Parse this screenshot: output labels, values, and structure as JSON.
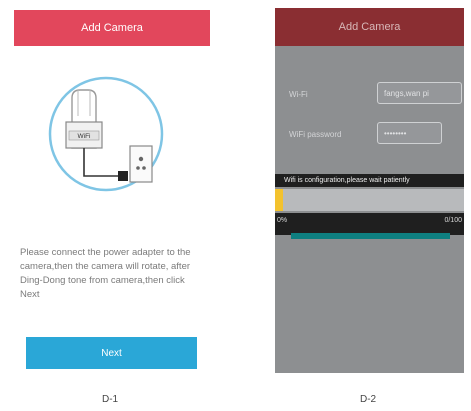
{
  "left_screen": {
    "title": "Add Camera",
    "illustration": {
      "wifi_label": "WiFi",
      "icon": "power-adapter-illustration"
    },
    "instruction": "Please connect the power adapter to the camera,then the camera will rotate, after Ding-Dong tone from camera,then click Next",
    "next_label": "Next",
    "caption": "D-1"
  },
  "right_screen": {
    "title": "Add Camera",
    "wifi_label": "Wi-Fi",
    "wifi_value": "fangs,wan pi",
    "password_label": "WiFi password",
    "password_value": "••••••••",
    "status_text": "Wifi is configuration,please wait patiently",
    "progress": {
      "fraction": 0.04,
      "start_label": "0%",
      "end_label": "0/100"
    },
    "caption": "D-2"
  },
  "colors": {
    "header_left": "#e2475c",
    "header_right": "#8a2e32",
    "next_button": "#2aa7d7",
    "progress_fill": "#f3c22e",
    "teal_bar": "#0e7f80"
  }
}
